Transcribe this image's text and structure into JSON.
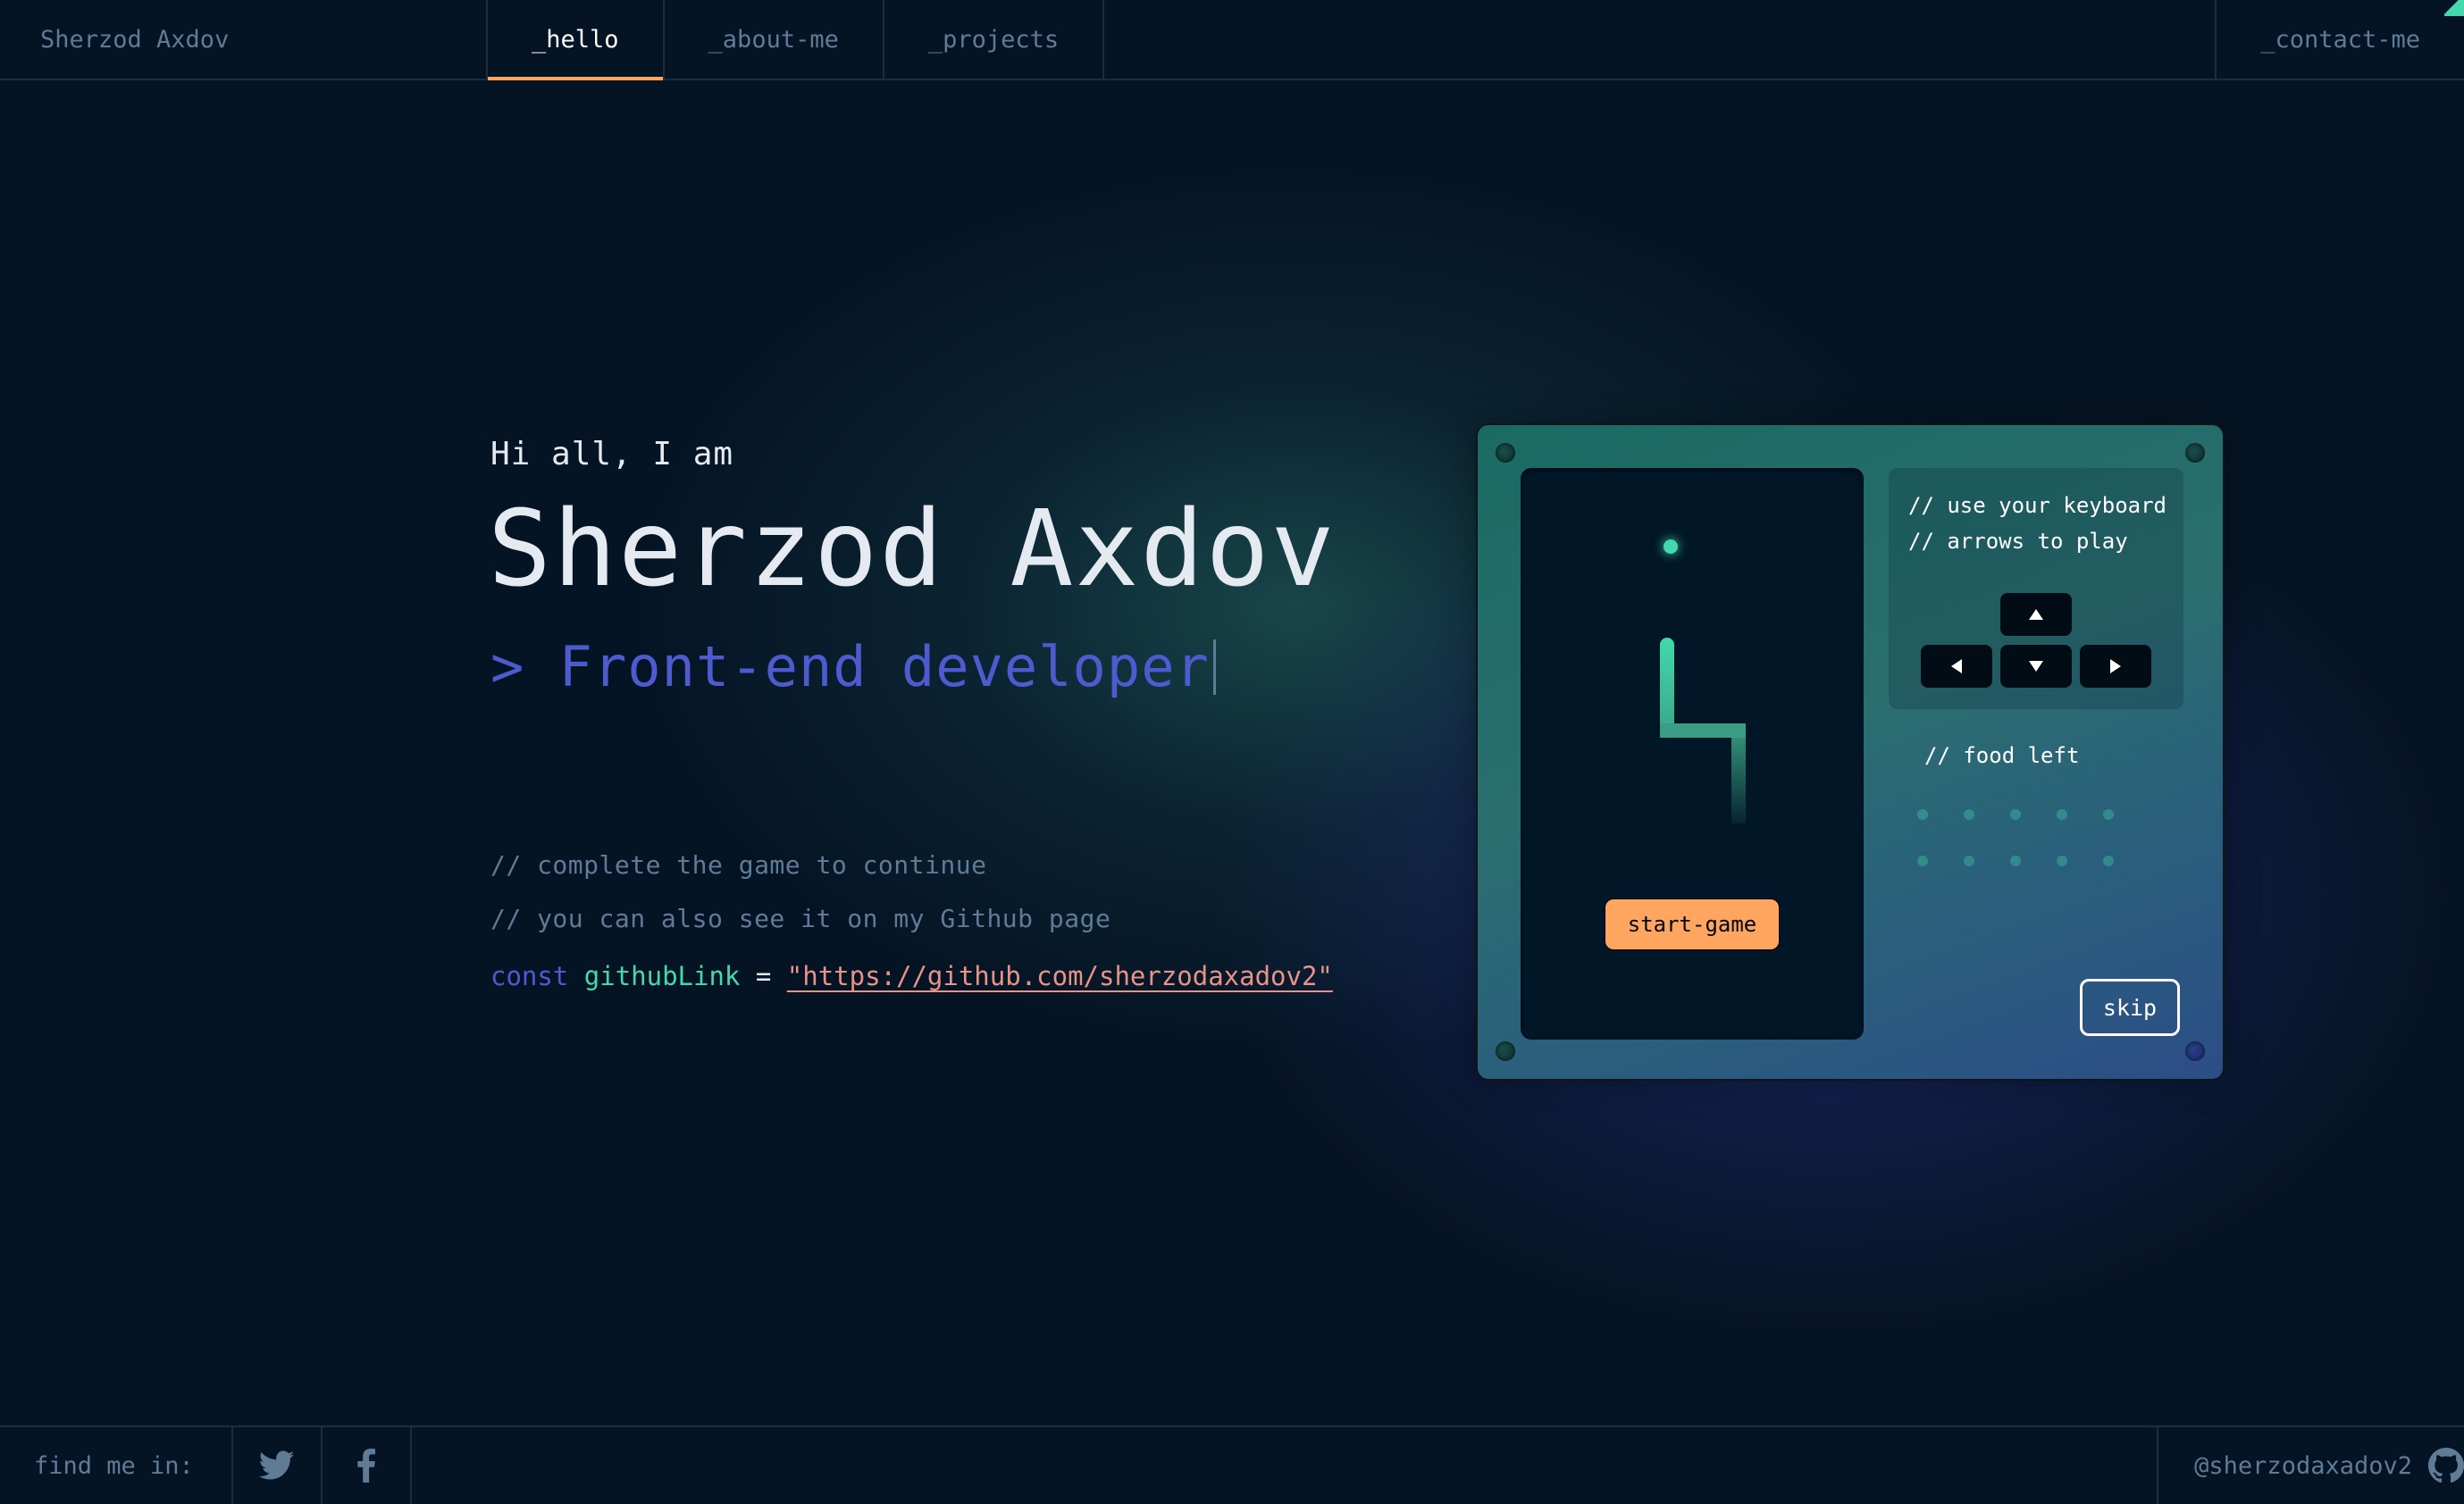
{
  "header": {
    "brand": "Sherzod Axdov",
    "tabs": [
      {
        "label": "_hello"
      },
      {
        "label": "_about-me"
      },
      {
        "label": "_projects"
      }
    ],
    "contact_label": "_contact-me"
  },
  "hero": {
    "greeting": "Hi all, I am",
    "name": "Sherzod Axdov",
    "role": "> Front-end developer",
    "comment_1": "// complete the game to continue",
    "comment_2": "// you can also see it on my Github page",
    "code_keyword": "const",
    "code_var": "githubLink",
    "code_op": "=",
    "code_link": "\"https://github.com/sherzodaxadov2\""
  },
  "game": {
    "instructions_line_1": "// use your keyboard",
    "instructions_line_2": "// arrows to play",
    "food_left_label": "// food left",
    "food_left_count": 10,
    "start_label": "start-game",
    "skip_label": "skip",
    "colors": {
      "snake": "#43d9ad",
      "start_button": "#fea55f"
    }
  },
  "footer": {
    "find_label": "find me in:",
    "socials": [
      {
        "icon": "twitter-icon"
      },
      {
        "icon": "facebook-icon"
      }
    ],
    "github_handle": "@sherzodaxadov2",
    "github_icon": "github-icon"
  },
  "colors": {
    "background": "#051424",
    "accent_orange": "#fea55f",
    "accent_teal": "#43d9ad",
    "accent_purple": "#4d5bce",
    "string": "#e99287",
    "muted": "#607b96"
  }
}
